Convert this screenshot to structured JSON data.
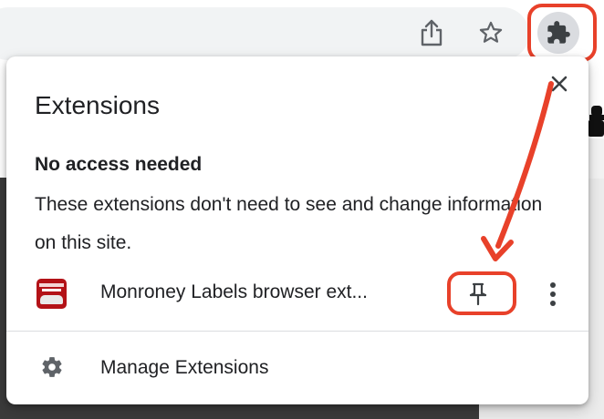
{
  "toolbar": {
    "share_icon": "share-icon",
    "star_icon": "bookmark-star-icon",
    "extensions_icon": "puzzle-piece-icon"
  },
  "popup": {
    "title": "Extensions",
    "close_icon": "close-icon",
    "section": {
      "heading": "No access needed",
      "description": "These extensions don't need to see and change information on this site."
    },
    "extensions": [
      {
        "name": "Monroney Labels browser ext...",
        "pin_icon": "pin-icon",
        "more_icon": "more-vert-icon"
      }
    ],
    "manage": {
      "label": "Manage Extensions",
      "icon": "gear-icon"
    }
  },
  "annotations": {
    "color": "#e8412a"
  },
  "colors": {
    "text": "#202124",
    "icon": "#5f6368",
    "extension_button_bg": "#dadce0"
  }
}
